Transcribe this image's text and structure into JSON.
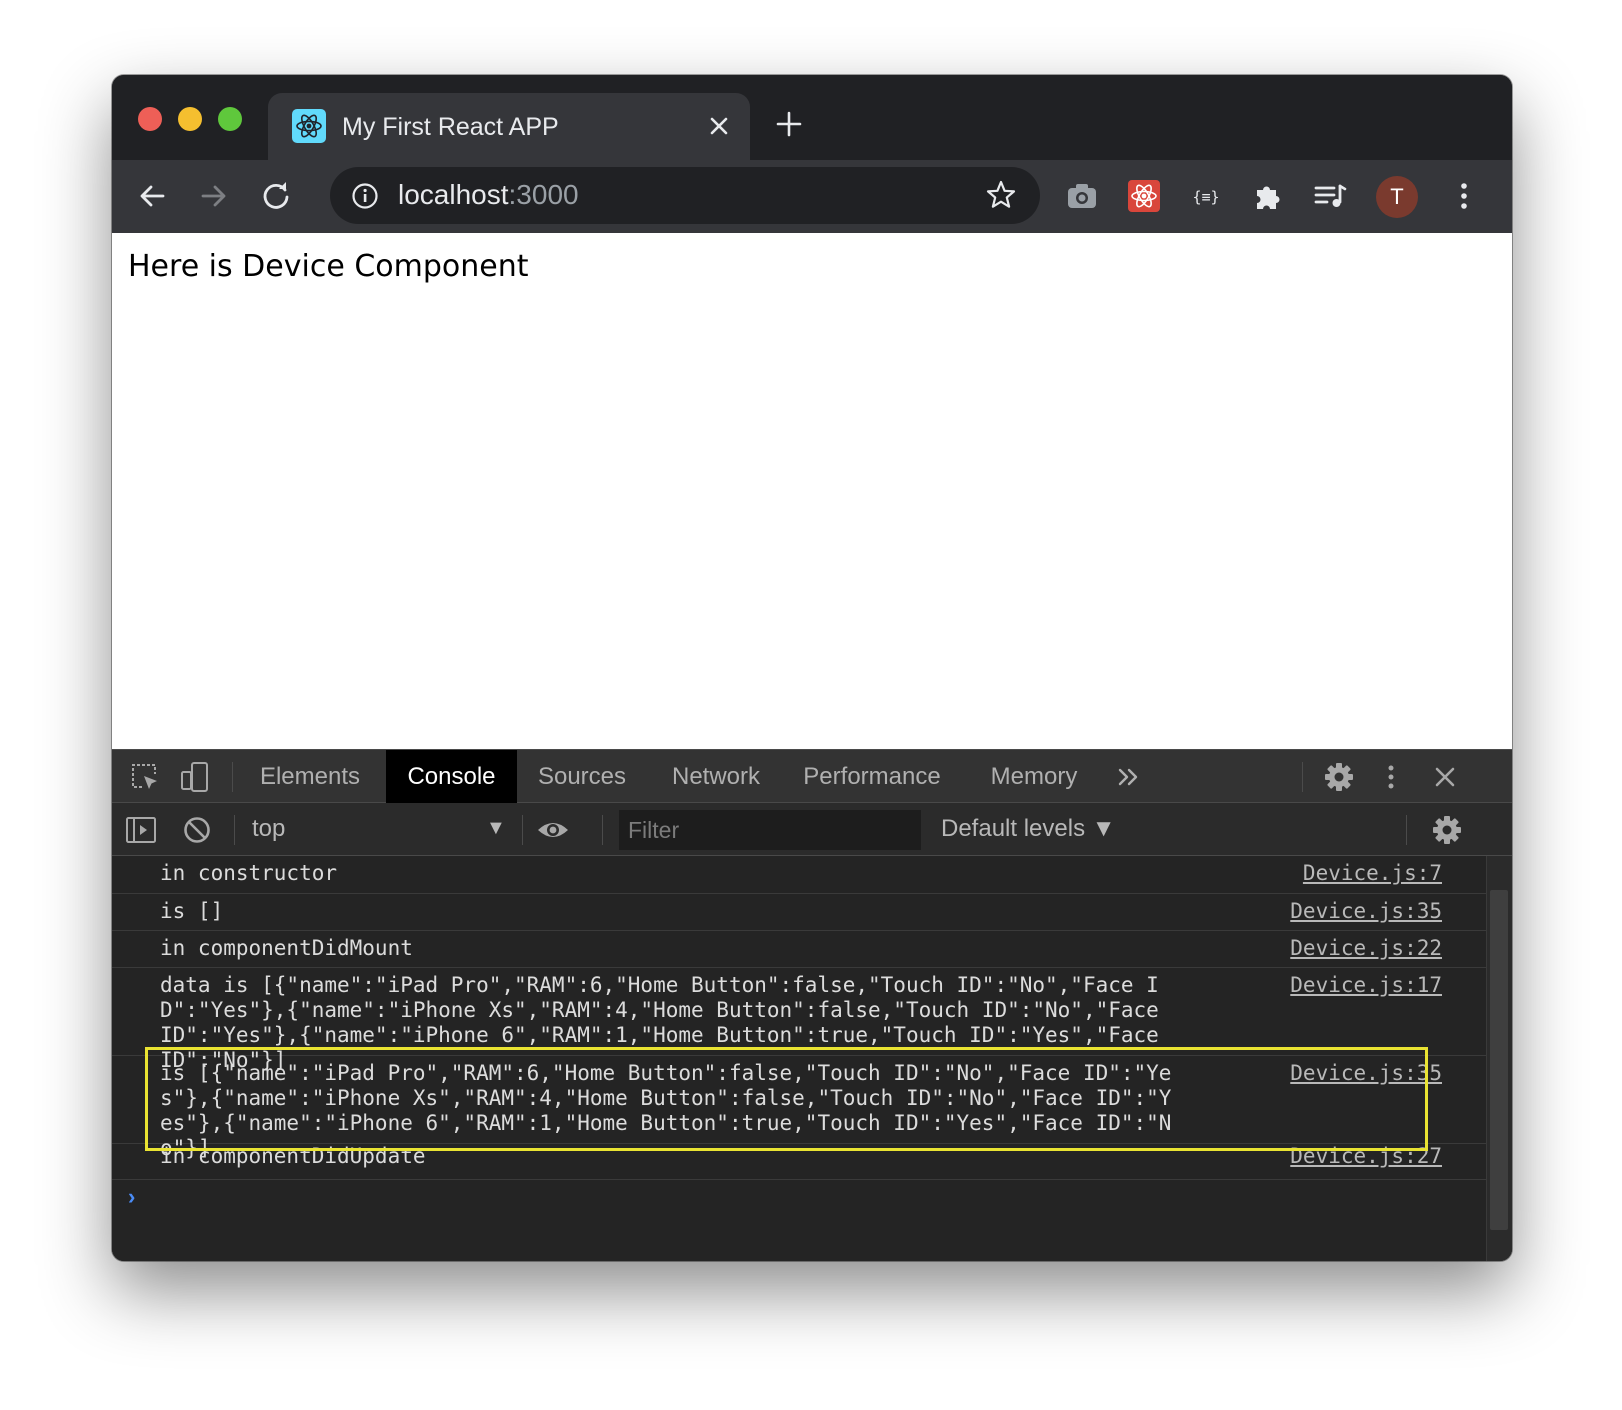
{
  "browser": {
    "tab": {
      "title": "My First React APP"
    },
    "address": {
      "host": "localhost",
      "port": ":3000"
    },
    "profile_initial": "T"
  },
  "page": {
    "text": "Here is Device Component"
  },
  "devtools": {
    "tabs": [
      "Elements",
      "Console",
      "Sources",
      "Network",
      "Performance",
      "Memory"
    ],
    "active_tab": "Console",
    "context": "top",
    "filter_placeholder": "Filter",
    "levels": "Default levels",
    "messages": [
      {
        "text": "in constructor",
        "source": "Device.js:7"
      },
      {
        "text": "is []",
        "source": "Device.js:35"
      },
      {
        "text": "in componentDidMount",
        "source": "Device.js:22"
      },
      {
        "text": "data is [{\"name\":\"iPad Pro\",\"RAM\":6,\"Home Button\":false,\"Touch ID\":\"No\",\"Face ID\":\"Yes\"},{\"name\":\"iPhone Xs\",\"RAM\":4,\"Home Button\":false,\"Touch ID\":\"No\",\"Face ID\":\"Yes\"},{\"name\":\"iPhone 6\",\"RAM\":1,\"Home Button\":true,\"Touch ID\":\"Yes\",\"Face ID\":\"No\"}]",
        "source": "Device.js:17"
      },
      {
        "text": "is [{\"name\":\"iPad Pro\",\"RAM\":6,\"Home Button\":false,\"Touch ID\":\"No\",\"Face ID\":\"Yes\"},{\"name\":\"iPhone Xs\",\"RAM\":4,\"Home Button\":false,\"Touch ID\":\"No\",\"Face ID\":\"Yes\"},{\"name\":\"iPhone 6\",\"RAM\":1,\"Home Button\":true,\"Touch ID\":\"Yes\",\"Face ID\":\"No\"}]",
        "source": "Device.js:35"
      },
      {
        "text": "in componentDidUpdate",
        "source": "Device.js:27"
      }
    ]
  },
  "colors": {
    "highlight": "#e9e332",
    "prompt": "#4a8cf7",
    "traffic_red": "#ee5f57",
    "traffic_yellow": "#f5bf2f",
    "traffic_green": "#5fc83c"
  }
}
